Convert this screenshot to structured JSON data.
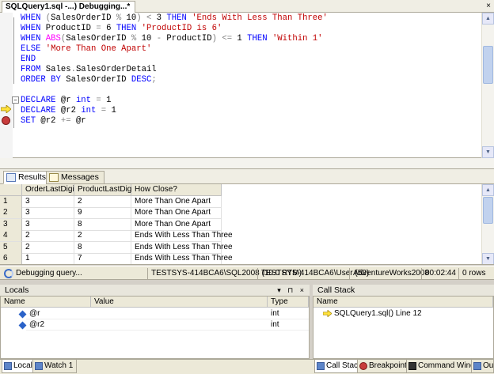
{
  "document": {
    "tab_title": "SQLQuery1.sql -...) Debugging...*",
    "close_glyph": "×"
  },
  "editor": {
    "lines": [
      [
        [
          "kw",
          "WHEN"
        ],
        [
          "op",
          " ("
        ],
        [
          "n",
          "SalesOrderID "
        ],
        [
          "op",
          "%"
        ],
        [
          "n",
          " 10"
        ],
        [
          "op",
          ") <"
        ],
        [
          "n",
          " 3 "
        ],
        [
          "kw",
          "THEN"
        ],
        [
          "n",
          " "
        ],
        [
          "str",
          "'Ends With Less Than Three'"
        ]
      ],
      [
        [
          "kw",
          "WHEN"
        ],
        [
          "n",
          " ProductID "
        ],
        [
          "op",
          "="
        ],
        [
          "n",
          " 6 "
        ],
        [
          "kw",
          "THEN"
        ],
        [
          "n",
          " "
        ],
        [
          "str",
          "'ProductID is 6'"
        ]
      ],
      [
        [
          "kw",
          "WHEN"
        ],
        [
          "n",
          " "
        ],
        [
          "fn",
          "ABS"
        ],
        [
          "op",
          "("
        ],
        [
          "n",
          "SalesOrderID "
        ],
        [
          "op",
          "%"
        ],
        [
          "n",
          " 10 "
        ],
        [
          "op",
          "-"
        ],
        [
          "n",
          " ProductID"
        ],
        [
          "op",
          ") <="
        ],
        [
          "n",
          " 1 "
        ],
        [
          "kw",
          "THEN"
        ],
        [
          "n",
          " "
        ],
        [
          "str",
          "'Within 1'"
        ]
      ],
      [
        [
          "kw",
          "ELSE"
        ],
        [
          "n",
          " "
        ],
        [
          "str",
          "'More Than One Apart'"
        ]
      ],
      [
        [
          "kw",
          "END"
        ]
      ],
      [
        [
          "kw",
          "FROM"
        ],
        [
          "n",
          " Sales"
        ],
        [
          "op",
          "."
        ],
        [
          "n",
          "SalesOrderDetail"
        ]
      ],
      [
        [
          "kw",
          "ORDER BY"
        ],
        [
          "n",
          " SalesOrderID "
        ],
        [
          "kw",
          "DESC"
        ],
        [
          "op",
          ";"
        ]
      ],
      [],
      [
        [
          "kw",
          "DECLARE"
        ],
        [
          "n",
          " @r "
        ],
        [
          "kw",
          "int"
        ],
        [
          "n",
          " "
        ],
        [
          "op",
          "="
        ],
        [
          "n",
          " 1"
        ]
      ],
      [
        [
          "kw",
          "DECLARE"
        ],
        [
          "n",
          " @r2 "
        ],
        [
          "kw",
          "int"
        ],
        [
          "n",
          " "
        ],
        [
          "op",
          "="
        ],
        [
          "n",
          " 1"
        ]
      ],
      [
        [
          "kw",
          "SET"
        ],
        [
          "n",
          " @r2 "
        ],
        [
          "op",
          "+="
        ],
        [
          "n",
          " @r"
        ]
      ]
    ]
  },
  "results": {
    "tabs": [
      "Results",
      "Messages"
    ],
    "columns": [
      "",
      "OrderLastDigit",
      "ProductLastDigit",
      "How Close?"
    ],
    "rows": [
      [
        "1",
        "3",
        "2",
        "More Than One Apart"
      ],
      [
        "2",
        "3",
        "9",
        "More Than One Apart"
      ],
      [
        "3",
        "3",
        "8",
        "More Than One Apart"
      ],
      [
        "4",
        "2",
        "2",
        "Ends With Less Than Three"
      ],
      [
        "5",
        "2",
        "8",
        "Ends With Less Than Three"
      ],
      [
        "6",
        "1",
        "7",
        "Ends With Less Than Three"
      ]
    ]
  },
  "status": {
    "message": "Debugging query...",
    "server": "TESTSYS-414BCA6\\SQL2008 (10.0 RTM)",
    "user": "TESTSYS-414BCA6\\User (52)",
    "database": "AdventureWorks2008",
    "elapsed": "00:02:44",
    "rows": "0 rows"
  },
  "locals": {
    "title": "Locals",
    "pin_glyphs": "▾ ⊓ ×",
    "columns": [
      "Name",
      "Value",
      "Type"
    ],
    "vars": [
      {
        "name": "@r",
        "value": "",
        "type": "int"
      },
      {
        "name": "@r2",
        "value": "",
        "type": "int"
      }
    ]
  },
  "callstack": {
    "title": "Call Stack",
    "columns": [
      "Name"
    ],
    "frames": [
      "SQLQuery1.sql() Line 12"
    ]
  },
  "tool_tabs": [
    "Locals",
    "Watch 1",
    "Call Stack",
    "Breakpoints",
    "Command Window",
    "Out"
  ]
}
